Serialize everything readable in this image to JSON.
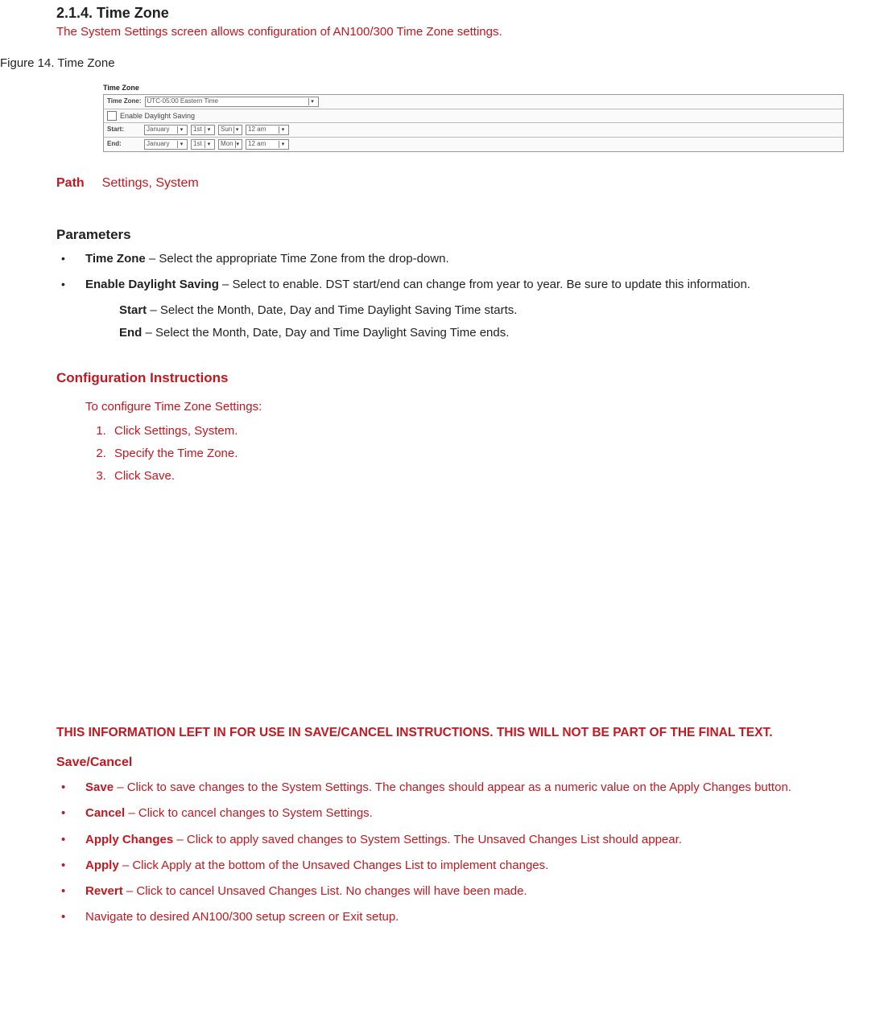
{
  "heading": "2.1.4. Time Zone",
  "intro": "The System Settings screen allows configuration of AN100/300 Time Zone settings.",
  "figure_caption": "Figure 14. Time Zone",
  "screenshot": {
    "tz_title": "Time Zone",
    "row_tz_label": "Time Zone:",
    "row_tz_value": "UTC-05:00 Eastern Time",
    "row_enable": "Enable Daylight Saving",
    "row_start_label": "Start:",
    "row_end_label": "End:",
    "month": "January",
    "date_start": "1st",
    "day_start": "Sun",
    "date_end": "1st",
    "day_end": "Mon",
    "time": "12 am"
  },
  "path_label": "Path",
  "path_value": "Settings, System",
  "params_heading": "Parameters",
  "params": {
    "tz_name": "Time Zone",
    "tz_desc": " – Select the appropriate Time Zone from the drop-down.",
    "dst_name": "Enable Daylight Saving",
    "dst_desc": " – Select to enable. DST start/end can change from year to year. Be sure to update this information.",
    "start_name": "Start",
    "start_desc": " – Select the Month, Date, Day and Time Daylight Saving Time starts.",
    "end_name": "End",
    "end_desc": " – Select the Month, Date, Day and Time Daylight Saving Time ends."
  },
  "config_heading": "Configuration Instructions",
  "config_intro": "To configure Time Zone Settings:",
  "config_steps": [
    "Click Settings, System.",
    "Specify the Time Zone.",
    "Click Save."
  ],
  "editorial_note": "THIS INFORMATION LEFT IN FOR USE IN SAVE/CANCEL INSTRUCTIONS. THIS WILL NOT BE PART OF THE FINAL TEXT.",
  "save_heading": "Save/Cancel",
  "save_items": [
    {
      "name": "Save",
      "desc": " – Click to save changes to the System Settings. The changes should appear as a numeric value on the Apply Changes button."
    },
    {
      "name": "Cancel",
      "desc": " – Click to cancel changes to System Settings."
    },
    {
      "name": "Apply Changes",
      "desc": " – Click to apply saved changes to System Settings. The Unsaved Changes List should appear."
    },
    {
      "name": "Apply",
      "desc": " – Click Apply at the bottom of the Unsaved Changes List to implement changes."
    },
    {
      "name": "Revert",
      "desc": " – Click to cancel Unsaved Changes List. No changes will have been made."
    }
  ],
  "save_last": "Navigate to desired AN100/300 setup screen or Exit setup."
}
